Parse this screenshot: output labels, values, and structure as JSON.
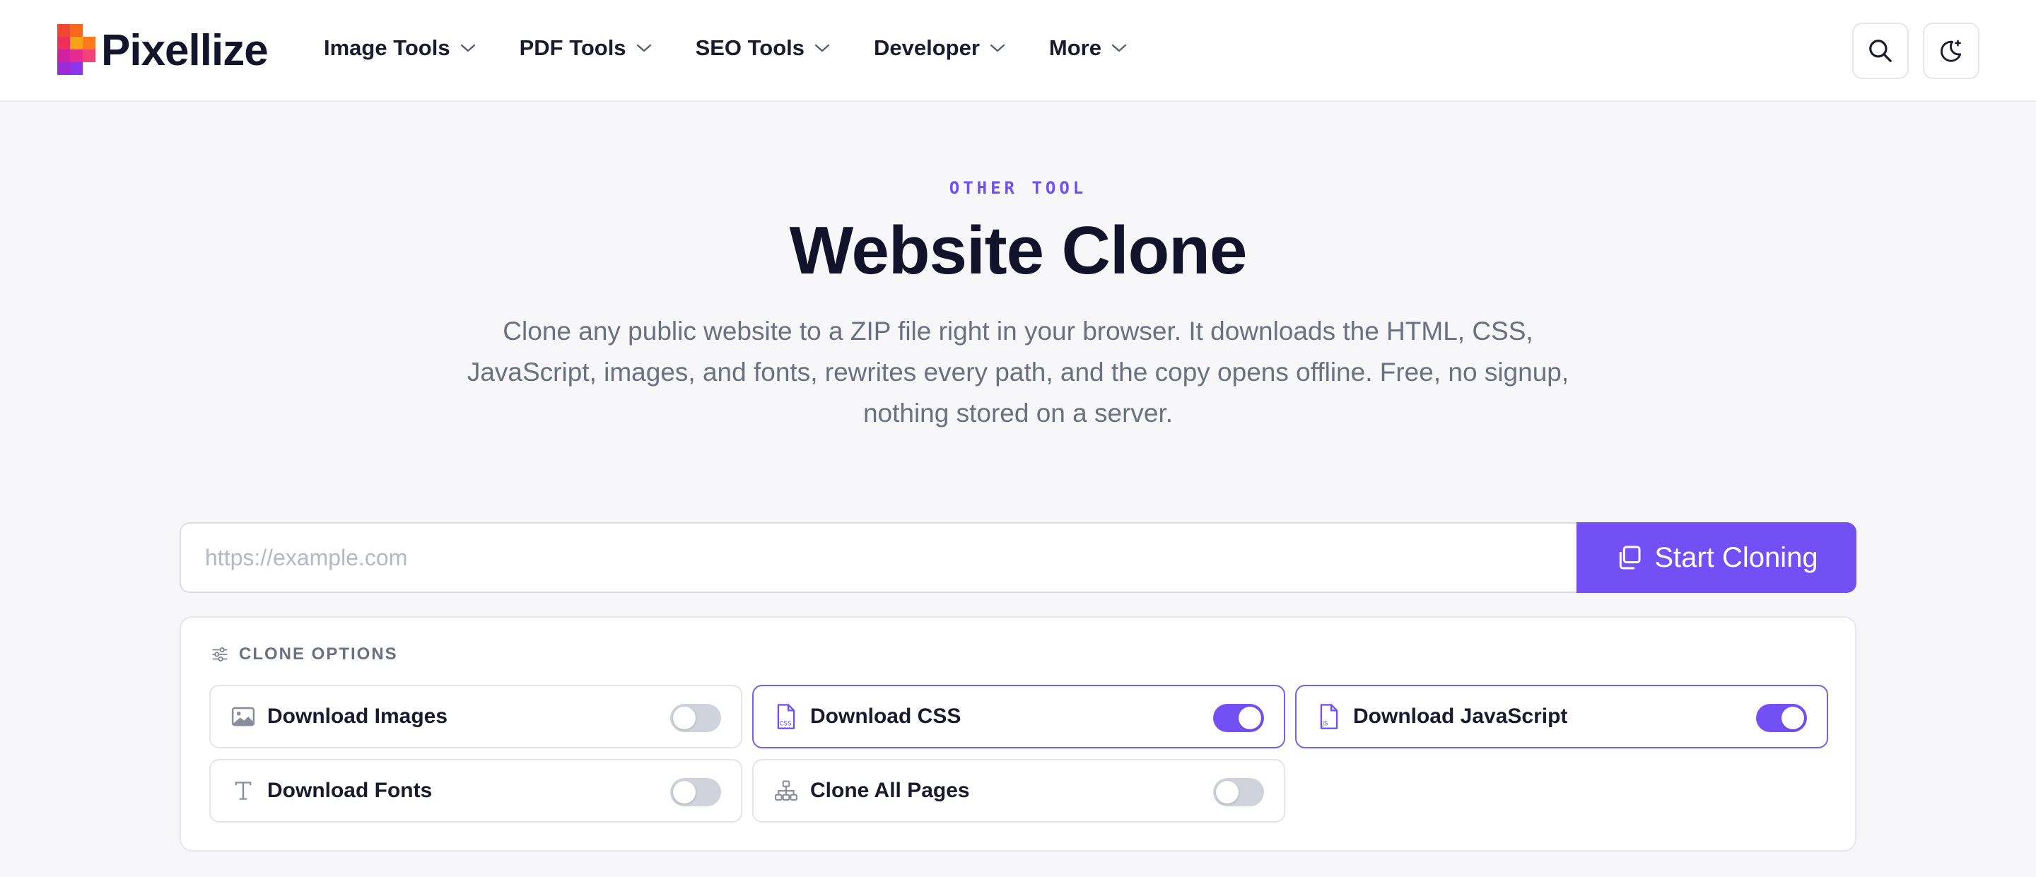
{
  "brand": {
    "name": "Pixellize",
    "accent": "#7350f6"
  },
  "nav": [
    {
      "label": "Image Tools"
    },
    {
      "label": "PDF Tools"
    },
    {
      "label": "SEO Tools"
    },
    {
      "label": "Developer"
    },
    {
      "label": "More"
    }
  ],
  "header_actions": {
    "search_icon": "search-icon",
    "theme_icon": "moon-sparkle-icon"
  },
  "hero": {
    "eyebrow": "OTHER TOOL",
    "title": "Website Clone",
    "description": "Clone any public website to a ZIP file right in your browser. It downloads the HTML, CSS, JavaScript, images, and fonts, rewrites every path, and the copy opens offline. Free, no signup, nothing stored on a server."
  },
  "url_form": {
    "placeholder": "https://example.com",
    "value": "",
    "button_label": "Start Cloning"
  },
  "options": {
    "title": "CLONE OPTIONS",
    "items": [
      {
        "label": "Download Images",
        "enabled": false,
        "icon": "image-icon"
      },
      {
        "label": "Download CSS",
        "enabled": true,
        "icon": "css-file-icon"
      },
      {
        "label": "Download JavaScript",
        "enabled": true,
        "icon": "js-file-icon"
      },
      {
        "label": "Download Fonts",
        "enabled": false,
        "icon": "font-icon"
      },
      {
        "label": "Clone All Pages",
        "enabled": false,
        "icon": "sitemap-icon"
      }
    ]
  }
}
